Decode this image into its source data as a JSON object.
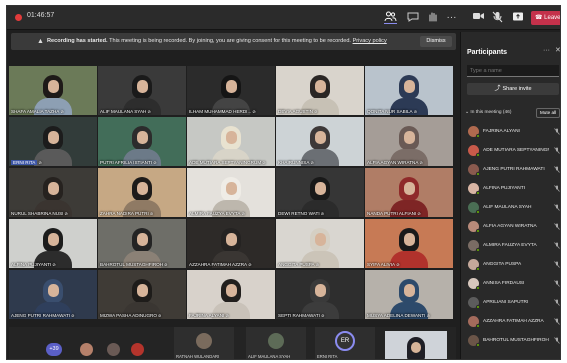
{
  "meeting": {
    "timer": "01:46:57"
  },
  "toolbar": {
    "people_icon": "people-icon",
    "chat_icon": "chat-icon",
    "react_icon": "hand-icon",
    "more_icon": "more-icon",
    "camera_icon": "camera-off-icon",
    "mic_icon": "mic-off-icon",
    "share_icon": "share-icon",
    "leave_label": "Leave",
    "leave_color": "#c4314b"
  },
  "banner": {
    "title": "Recording has started.",
    "message": "This meeting is being recorded. By joining, you are giving consent for this meeting to be recorded.",
    "link": "Privacy policy",
    "dismiss": "Dismiss"
  },
  "tiles": [
    {
      "name": "SHAFA AMALIA TAZHA",
      "bg": "#6b7a58",
      "hair": "#1e1a18",
      "shirt": "#8d9fb3"
    },
    {
      "name": "ALIF MAULANA SYAH",
      "bg": "#3a3a3a",
      "hair": "#1a1a1a",
      "shirt": "#2d2d2d"
    },
    {
      "name": "ILHAM MUHAMMAD HERDI...",
      "bg": "#2b2b2b",
      "hair": "#151515",
      "shirt": "#444"
    },
    {
      "name": "DEVIA AGUSTIN",
      "bg": "#d9d4cc",
      "hair": "#2a2624",
      "shirt": "#c7c1b5"
    },
    {
      "name": "QONITA NUR SABILA",
      "bg": "#b9c3cc",
      "hair": "#2c3a55",
      "shirt": "#2c3a55"
    },
    {
      "name": "ERNI RITA",
      "bg": "#323c3a",
      "hair": "#1c1c1c",
      "shirt": "#5a5a5a",
      "chip": true
    },
    {
      "name": "PUTRI AFRILIA ISTIANTI",
      "bg": "#426d59",
      "hair": "#2c2c2c",
      "shirt": "#6c7a88"
    },
    {
      "name": "ADE MUTIARA SEPTYANINGRUM",
      "bg": "#c6c8c4",
      "hair": "#e8e2d0",
      "shirt": "#d8d4c8"
    },
    {
      "name": "KHAIRUNNISA",
      "bg": "#cdd3d6",
      "hair": "#3d3838",
      "shirt": "#6b6f74"
    },
    {
      "name": "ALFIA AGYAN WIRATNA",
      "bg": "#a59d97",
      "hair": "#6a5a55",
      "shirt": "#7b6d67"
    },
    {
      "name": "NURUL SHABRINA NUSI",
      "bg": "#3d3b37",
      "hair": "#26221f",
      "shirt": "#3a3430"
    },
    {
      "name": "ZAHRA NADIRA PUTRI",
      "bg": "#c6a884",
      "hair": "#1d1b1a",
      "shirt": "#8f7a64"
    },
    {
      "name": "ALMIRA FAUZYA EVYTA",
      "bg": "#e4e1dc",
      "hair": "#efece6",
      "shirt": "#bdb7ad"
    },
    {
      "name": "DEWI RETNO WATI",
      "bg": "#363636",
      "hair": "#191919",
      "shirt": "#2b2b2b"
    },
    {
      "name": "NANDA PUTRI ALFIANI",
      "bg": "#b07d66",
      "hair": "#8f2a2a",
      "shirt": "#7e2525"
    },
    {
      "name": "ALFINA PUJIYANTI",
      "bg": "#cfd0cd",
      "hair": "#1c1c1c",
      "shirt": "#2c2c2c"
    },
    {
      "name": "BAHROTUL MUSTAGHFIROH",
      "bg": "#6e6e68",
      "hair": "#242424",
      "shirt": "#8b8176"
    },
    {
      "name": "AZZAHRA FATIMAH AZZRA",
      "bg": "#2d2a28",
      "hair": "#252322",
      "shirt": "#3a3633"
    },
    {
      "name": "ANGGITA PUSPA",
      "bg": "#d9d6d0",
      "hair": "#d5cfc3",
      "shirt": "#cbc4b8"
    },
    {
      "name": "SYIFA ALIVIA",
      "bg": "#c77a55",
      "hair": "#1a1a1a",
      "shirt": "#b1322c"
    },
    {
      "name": "AJENG PUTRI RAHMAWATI",
      "bg": "#2f3a4d",
      "hair": "#3a4e6e",
      "shirt": "#2f3f5c"
    },
    {
      "name": "MIZWA PASHA ADINUGRO",
      "bg": "#3f3b36",
      "hair": "#1e1c1a",
      "shirt": "#3a3632"
    },
    {
      "name": "FAJRINA ALYANI",
      "bg": "#d8d2cb",
      "hair": "#221f1d",
      "shirt": "#c9c2b9"
    },
    {
      "name": "SEPTI RAHMAWATI",
      "bg": "#2e2e2e",
      "hair": "#3a3a3a",
      "shirt": "#3c3c3c"
    },
    {
      "name": "MUSYA ADELINA DEWANTI",
      "bg": "#b6b1aa",
      "hair": "#2d4a6b",
      "shirt": "#2d4a6b"
    }
  ],
  "strip": {
    "overflow": "+39",
    "tiles": [
      {
        "name": "RATNAH WULANDARI"
      },
      {
        "name": "ALIF MAULANA SYAH"
      },
      {
        "name": "ERNI RITA",
        "initials": "ER"
      }
    ]
  },
  "panel": {
    "title": "Participants",
    "more_icon": "more-icon",
    "close_icon": "close-icon",
    "search_placeholder": "Type a name",
    "share_invite": "Share invite",
    "section": "In this meeting (46)",
    "mute_all": "Mute all",
    "participants": [
      {
        "name": "FAJRINA ALYANI",
        "color": "#b06a4f"
      },
      {
        "name": "ADE MUTIARA SEPTYANINGR...",
        "color": "#c85a4a"
      },
      {
        "name": "AJENG PUTRI RAHMAWATI",
        "color": "#8a5a4e"
      },
      {
        "name": "ALFINA PUJIYANTI",
        "color": "#d8b5a4"
      },
      {
        "name": "ALIF MAULANA SYAH",
        "color": "#4a6e54"
      },
      {
        "name": "ALFIA AGYAN WIRATNA",
        "color": "#b88a7a"
      },
      {
        "name": "ALMIRA FAUZYA EVYTA",
        "color": "#7a6c64"
      },
      {
        "name": "ANGGITA PUSPA",
        "color": "#c4a89a"
      },
      {
        "name": "ANNISA FIRDAUSI",
        "color": "#d7c7bd"
      },
      {
        "name": "APRILIANI SAPUTRI",
        "color": "#5c5c5c"
      },
      {
        "name": "AZZAHRA FATIMAH AZZRA",
        "color": "#a46b5c"
      },
      {
        "name": "BAHROTUL MUSTAGHFIROH",
        "color": "#6b5548"
      }
    ]
  }
}
